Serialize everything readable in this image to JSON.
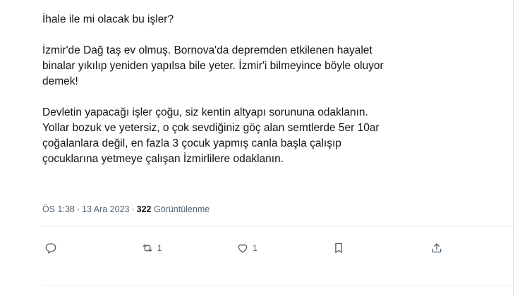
{
  "tweet": {
    "paragraphs": [
      {
        "lines": [
          "İhale ile mi olacak bu işler?"
        ]
      },
      {
        "lines": [
          "İzmir'de Dağ taş ev olmuş. Bornova'da depremden etkilenen hayalet",
          "binalar yıkılıp yeniden yapılsa bile yeter. İzmir'i bilmeyince böyle oluyor",
          "demek!"
        ]
      },
      {
        "lines": [
          "Devletin yapacağı işler çoğu, siz kentin altyapı sorununa odaklanın.",
          "Yollar bozuk ve yetersiz, o çok sevdiğiniz göç alan semtlerde 5er 10ar",
          "çoğalanlara değil, en fazla 3 çocuk yapmış canla başla çalışıp",
          "çocuklarına yetmeye çalışan İzmirlilere odaklanın."
        ]
      }
    ]
  },
  "meta": {
    "time": "ÖS 1:38",
    "separator": "·",
    "date": "13 Ara 2023",
    "views_count": "322",
    "views_label": "Görüntülenme"
  },
  "actions": {
    "reply": {
      "icon": "reply-icon",
      "count": ""
    },
    "retweet": {
      "icon": "retweet-icon",
      "count": "1"
    },
    "like": {
      "icon": "heart-icon",
      "count": "1"
    },
    "bookmark": {
      "icon": "bookmark-icon",
      "count": ""
    },
    "share": {
      "icon": "share-icon",
      "count": ""
    }
  },
  "colors": {
    "text": "#0f1419",
    "secondary": "#536471",
    "divider": "#eff3f4",
    "background": "#ffffff"
  }
}
